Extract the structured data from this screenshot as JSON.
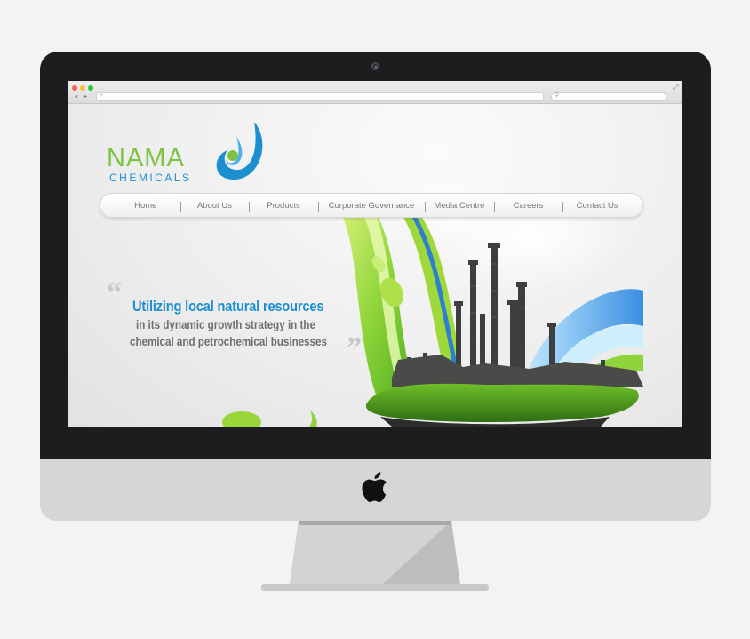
{
  "browser": {
    "nav_back": "◂",
    "nav_forward": "▸",
    "address_icon": "+",
    "search_icon": "search-icon",
    "expand_icon": "expand-icon"
  },
  "site": {
    "logo": {
      "name": "NAMA",
      "subname": "CHEMICALS"
    },
    "nav": [
      {
        "label": "Home"
      },
      {
        "label": "About Us"
      },
      {
        "label": "Products"
      },
      {
        "label": "Corporate Governance"
      },
      {
        "label": "Media Centre"
      },
      {
        "label": "Careers"
      },
      {
        "label": "Contact Us"
      }
    ],
    "hero": {
      "headline": "Utilizing local natural resources",
      "line2": "in its dynamic growth strategy in the",
      "line3": "chemical and petrochemical businesses"
    }
  },
  "colors": {
    "brand_green": "#7cc243",
    "brand_blue": "#1b8fd0",
    "bezel": "#1d1d1f",
    "chin": "#d6d6d6"
  }
}
